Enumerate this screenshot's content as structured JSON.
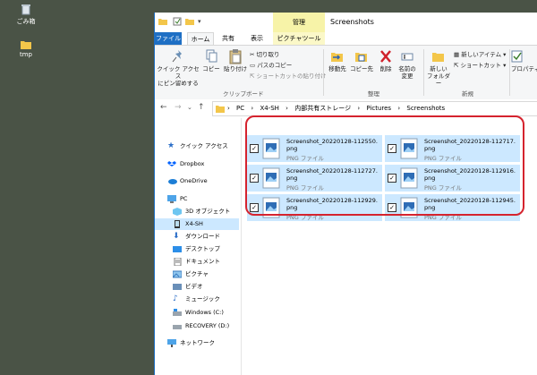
{
  "desktop": {
    "recycle_bin_label": "ごみ箱",
    "tmp_label": "tmp"
  },
  "window": {
    "title": "Screenshots",
    "contextual_tab_group": "管理"
  },
  "ribbon_tabs": [
    "ファイル",
    "ホーム",
    "共有",
    "表示",
    "ピクチャツール"
  ],
  "ribbon": {
    "pin_label_1": "クイック アクセス",
    "pin_label_2": "にピン留めする",
    "copy_label": "コピー",
    "paste_label": "貼り付け",
    "cut_label": "切り取り",
    "copy_path_label": "パスのコピー",
    "paste_shortcut_label": "ショートカットの貼り付け",
    "clipboard_group": "クリップボード",
    "move_to_label": "移動先",
    "copy_to_label": "コピー先",
    "delete_label": "削除",
    "rename_label_1": "名前の",
    "rename_label_2": "変更",
    "organize_group": "整理",
    "new_folder_label_1": "新しい",
    "new_folder_label_2": "フォルダー",
    "new_item_label": "新しいアイテム",
    "shortcut_label": "ショートカット",
    "new_group": "新規",
    "properties_label": "プロパティ"
  },
  "address": {
    "crumbs": [
      "PC",
      "X4-SH",
      "内部共有ストレージ",
      "Pictures",
      "Screenshots"
    ]
  },
  "sidebar": {
    "items": [
      {
        "label": "クイック アクセス",
        "icon": "star-icon"
      },
      {
        "label": "Dropbox",
        "icon": "dropbox-icon"
      },
      {
        "label": "OneDrive",
        "icon": "cloud-icon"
      },
      {
        "label": "PC",
        "icon": "pc-icon"
      },
      {
        "label": "3D オブジェクト",
        "icon": "cube-icon"
      },
      {
        "label": "X4-SH",
        "icon": "phone-icon"
      },
      {
        "label": "ダウンロード",
        "icon": "download-icon"
      },
      {
        "label": "デスクトップ",
        "icon": "desktop-icon"
      },
      {
        "label": "ドキュメント",
        "icon": "document-icon"
      },
      {
        "label": "ピクチャ",
        "icon": "picture-icon"
      },
      {
        "label": "ビデオ",
        "icon": "video-icon"
      },
      {
        "label": "ミュージック",
        "icon": "music-icon"
      },
      {
        "label": "Windows (C:)",
        "icon": "drive-icon"
      },
      {
        "label": "RECOVERY (D:)",
        "icon": "drive-icon"
      },
      {
        "label": "ネットワーク",
        "icon": "network-icon"
      }
    ]
  },
  "files": [
    {
      "name": "Screenshot_20220128-112550.png",
      "type": "PNG ファイル",
      "checked": true
    },
    {
      "name": "Screenshot_20220128-112717.png",
      "type": "PNG ファイル",
      "checked": true
    },
    {
      "name": "Screenshot_20220128-112727.png",
      "type": "PNG ファイル",
      "checked": true
    },
    {
      "name": "Screenshot_20220128-112916.png",
      "type": "PNG ファイル",
      "checked": true
    },
    {
      "name": "Screenshot_20220128-112929.png",
      "type": "PNG ファイル",
      "checked": true
    },
    {
      "name": "Screenshot_20220128-112945.png",
      "type": "PNG ファイル",
      "checked": true
    }
  ],
  "colors": {
    "selection": "#cce8ff",
    "highlight_border": "#d5232e",
    "file_tab": "#1e6fc4",
    "contextual_tab": "#f7f3a8"
  }
}
